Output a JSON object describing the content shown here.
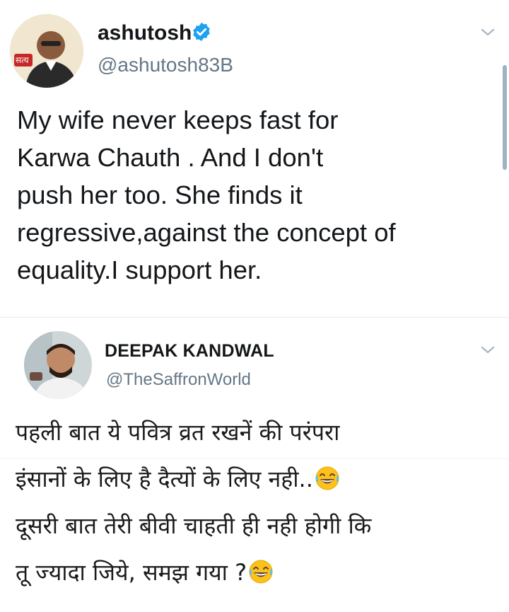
{
  "tweet1": {
    "display_name": "ashutosh",
    "handle": "@ashutosh83B",
    "avatar_badge": "सत्य",
    "text_lines": [
      "My wife never keeps fast for",
      "Karwa Chauth . And I don't",
      "push her too. She finds it",
      "regressive,against the concept of",
      "equality.I support her."
    ],
    "icons": {
      "verified": "verified-badge-icon",
      "menu": "chevron-down-icon"
    }
  },
  "tweet2": {
    "display_name": "DEEPAK KANDWAL",
    "handle": "@TheSaffronWorld",
    "text_lines": [
      "पहली बात ये पवित्र व्रत रखनें की परंपरा",
      "इंसानों के लिए है दैत्यों के लिए नही..",
      "दूसरी बात तेरी बीवी चाहती ही नही होगी कि",
      "तू ज्यादा जिये, समझ गया ?"
    ],
    "icons": {
      "emoji": "laughing-emoji-icon",
      "menu": "chevron-down-icon"
    }
  },
  "colors": {
    "text": "#14171a",
    "secondary": "#657786",
    "verified": "#1da1f2",
    "separator": "#e6ecf0"
  }
}
